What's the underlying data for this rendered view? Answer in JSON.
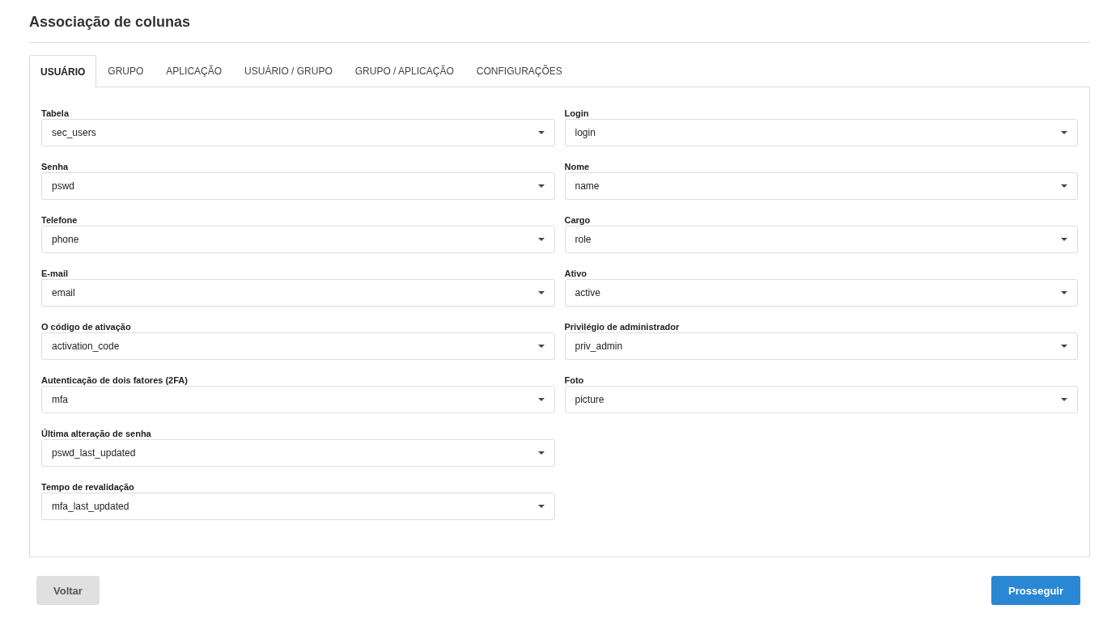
{
  "title": "Associação de colunas",
  "tabs": [
    {
      "label": "USUÁRIO",
      "selected": true
    },
    {
      "label": "GRUPO",
      "selected": false
    },
    {
      "label": "APLICAÇÃO",
      "selected": false
    },
    {
      "label": "USUÁRIO / GRUPO",
      "selected": false
    },
    {
      "label": "GRUPO / APLICAÇÃO",
      "selected": false
    },
    {
      "label": "CONFIGURAÇÕES",
      "selected": false
    }
  ],
  "left_fields": [
    {
      "label": "Tabela",
      "value": "sec_users"
    },
    {
      "label": "Senha",
      "value": "pswd"
    },
    {
      "label": "Telefone",
      "value": "phone"
    },
    {
      "label": "E-mail",
      "value": "email"
    },
    {
      "label": "O código de ativação",
      "value": "activation_code"
    },
    {
      "label": "Autenticação de dois fatores (2FA)",
      "value": "mfa"
    },
    {
      "label": "Última alteração de senha",
      "value": "pswd_last_updated"
    },
    {
      "label": "Tempo de revalidação",
      "value": "mfa_last_updated"
    }
  ],
  "right_fields": [
    {
      "label": "Login",
      "value": "login"
    },
    {
      "label": "Nome",
      "value": "name"
    },
    {
      "label": "Cargo",
      "value": "role"
    },
    {
      "label": "Ativo",
      "value": "active"
    },
    {
      "label": "Privilégio de administrador",
      "value": "priv_admin"
    },
    {
      "label": "Foto",
      "value": "picture"
    }
  ],
  "buttons": [
    {
      "label": "Voltar",
      "kind": "secondary"
    },
    {
      "label": "Prosseguir",
      "kind": "primary"
    }
  ]
}
